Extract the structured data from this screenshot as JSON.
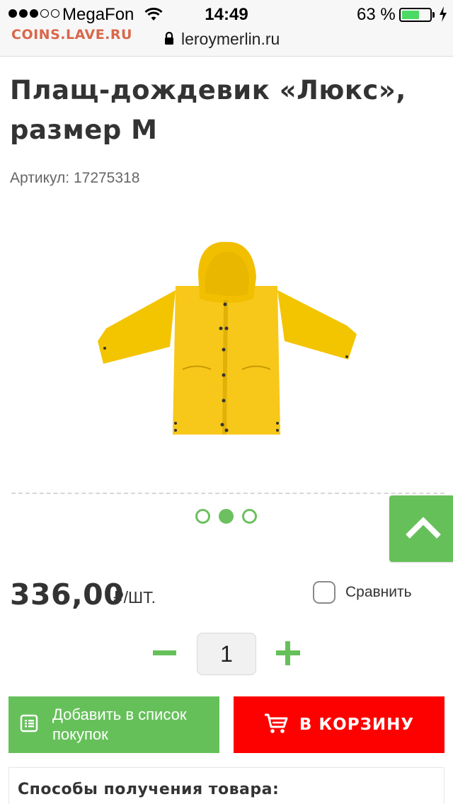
{
  "status_bar": {
    "carrier": "MegaFon",
    "signal_bars_filled": 3,
    "signal_bars_total": 5,
    "time": "14:49",
    "battery_percent": "63 %",
    "battery_level": 0.63
  },
  "browser": {
    "url": "leroymerlin.ru"
  },
  "watermark": "COINS.LAVE.RU",
  "product": {
    "title_line1": "Плащ-дождевик «Люкс»,",
    "title_line2": "размер M",
    "article": "Артикул: 17275318",
    "image_color": "#f5c518"
  },
  "gallery": {
    "slide_count": 3,
    "active_slide": 2
  },
  "price": {
    "amount": "336,00",
    "unit": "₽/ШТ."
  },
  "compare": {
    "label": "Сравнить",
    "checked": false
  },
  "quantity": {
    "value": "1"
  },
  "actions": {
    "add_to_list_label": "Добавить в список покупок",
    "add_to_cart_label": "В КОРЗИНУ"
  },
  "delivery": {
    "title": "Способы получения товара:"
  },
  "colors": {
    "accent_green": "#66c05a",
    "cart_red": "#fd0000",
    "watermark": "#d9674a"
  },
  "icons": {
    "lock": "lock-icon",
    "wifi": "wifi-icon",
    "scroll_top": "chevron-up-icon",
    "list": "list-icon",
    "cart": "cart-icon"
  }
}
